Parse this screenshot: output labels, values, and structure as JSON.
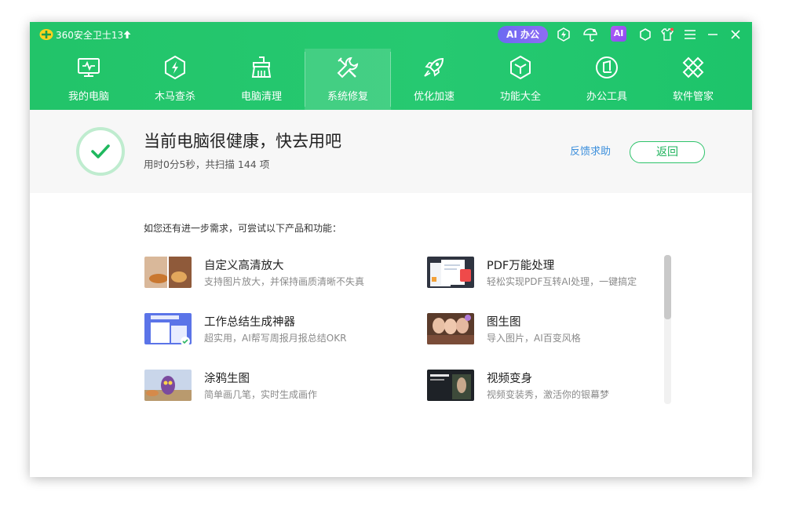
{
  "app": {
    "title": "360安全卫士13",
    "ai_office_label": "AI 办公",
    "ai_badge": "AI"
  },
  "titlebar_icons": [
    "lightning-icon",
    "umbrella-icon",
    "ai-badge",
    "settings-icon",
    "skin-icon",
    "menu-icon",
    "minimize-icon",
    "close-icon"
  ],
  "nav": {
    "items": [
      {
        "label": "我的电脑",
        "icon": "monitor-icon"
      },
      {
        "label": "木马查杀",
        "icon": "shield-icon"
      },
      {
        "label": "电脑清理",
        "icon": "broom-icon"
      },
      {
        "label": "系统修复",
        "icon": "wrench-icon",
        "active": true
      },
      {
        "label": "优化加速",
        "icon": "rocket-icon"
      },
      {
        "label": "功能大全",
        "icon": "cube-icon"
      },
      {
        "label": "办公工具",
        "icon": "office-icon"
      },
      {
        "label": "软件管家",
        "icon": "apps-icon"
      }
    ]
  },
  "status": {
    "title": "当前电脑很健康，快去用吧",
    "subtitle": "用时0分5秒，共扫描 144 项",
    "feedback_label": "反馈求助",
    "back_label": "返回"
  },
  "recommend": {
    "label": "如您还有进一步需求，可尝试以下产品和功能：",
    "items": [
      {
        "title": "自定义高清放大",
        "desc": "支持图片放大，并保持画质清晰不失真"
      },
      {
        "title": "PDF万能处理",
        "desc": "轻松实现PDF互转AI处理，一键搞定"
      },
      {
        "title": "工作总结生成神器",
        "desc": "超实用，AI帮写周报月报总结OKR"
      },
      {
        "title": "图生图",
        "desc": "导入图片，AI百变风格"
      },
      {
        "title": "涂鸦生图",
        "desc": "简单画几笔，实时生成画作"
      },
      {
        "title": "视频变身",
        "desc": "视频变装秀，激活你的银幕梦"
      }
    ]
  },
  "colors": {
    "brand_green": "#22c469",
    "link_blue": "#3c8fdc",
    "ai_purple": "#7a6bf3"
  }
}
